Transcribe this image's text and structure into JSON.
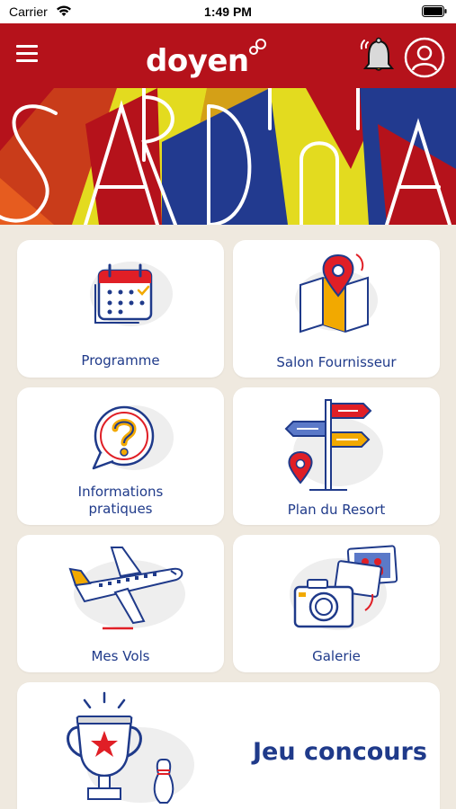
{
  "status_bar": {
    "carrier": "Carrier",
    "time": "1:49 PM"
  },
  "header": {
    "brand": "doyen",
    "menu_icon": "hamburger-icon",
    "notification_icon": "bell-icon",
    "profile_icon": "user-icon",
    "brand_color": "#b5121b"
  },
  "banner": {
    "text": "SARDINIA"
  },
  "tiles": [
    {
      "label": "Programme",
      "icon": "calendar-icon"
    },
    {
      "label": "Salon Fournisseur",
      "icon": "map-pin-icon"
    },
    {
      "label_line1": "Informations",
      "label_line2": "pratiques",
      "icon": "question-bubble-icon"
    },
    {
      "label": "Plan du Resort",
      "icon": "signpost-icon"
    },
    {
      "label": "Mes Vols",
      "icon": "airplane-icon"
    },
    {
      "label": "Galerie",
      "icon": "camera-icon"
    }
  ],
  "contest": {
    "label": "Jeu concours",
    "icon": "trophy-icon"
  },
  "colors": {
    "accent_blue": "#1f3a8a",
    "accent_red": "#e01f26",
    "accent_yellow": "#f2a900",
    "background": "#efe9df"
  }
}
